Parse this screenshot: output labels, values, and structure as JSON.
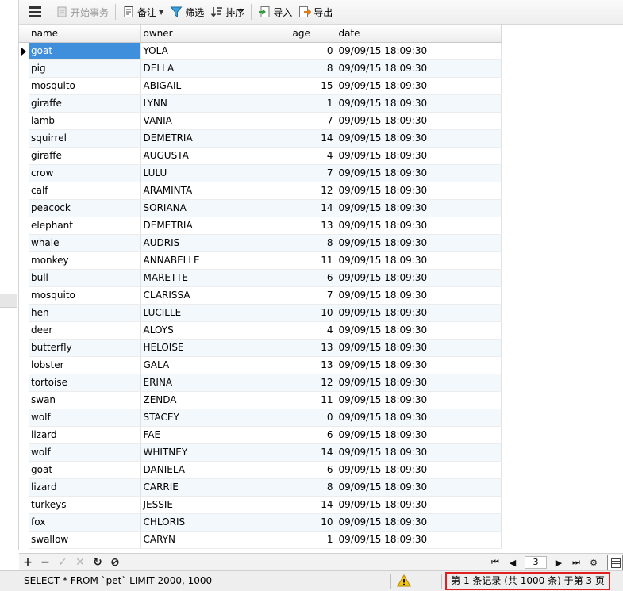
{
  "toolbar": {
    "begin_transaction": "开始事务",
    "memo": "备注",
    "filter": "筛选",
    "sort": "排序",
    "import": "导入",
    "export": "导出"
  },
  "grid": {
    "columns": [
      "name",
      "owner",
      "age",
      "date"
    ],
    "rows": [
      [
        "goat",
        "YOLA",
        "0",
        "09/09/15 18:09:30"
      ],
      [
        "pig",
        "DELLA",
        "8",
        "09/09/15 18:09:30"
      ],
      [
        "mosquito",
        "ABIGAIL",
        "15",
        "09/09/15 18:09:30"
      ],
      [
        "giraffe",
        "LYNN",
        "1",
        "09/09/15 18:09:30"
      ],
      [
        "lamb",
        "VANIA",
        "7",
        "09/09/15 18:09:30"
      ],
      [
        "squirrel",
        "DEMETRIA",
        "14",
        "09/09/15 18:09:30"
      ],
      [
        "giraffe",
        "AUGUSTA",
        "4",
        "09/09/15 18:09:30"
      ],
      [
        "crow",
        "LULU",
        "7",
        "09/09/15 18:09:30"
      ],
      [
        "calf",
        "ARAMINTA",
        "12",
        "09/09/15 18:09:30"
      ],
      [
        "peacock",
        "SORIANA",
        "14",
        "09/09/15 18:09:30"
      ],
      [
        "elephant",
        "DEMETRIA",
        "13",
        "09/09/15 18:09:30"
      ],
      [
        "whale",
        "AUDRIS",
        "8",
        "09/09/15 18:09:30"
      ],
      [
        "monkey",
        "ANNABELLE",
        "11",
        "09/09/15 18:09:30"
      ],
      [
        "bull",
        "MARETTE",
        "6",
        "09/09/15 18:09:30"
      ],
      [
        "mosquito",
        "CLARISSA",
        "7",
        "09/09/15 18:09:30"
      ],
      [
        "hen",
        "LUCILLE",
        "10",
        "09/09/15 18:09:30"
      ],
      [
        "deer",
        "ALOYS",
        "4",
        "09/09/15 18:09:30"
      ],
      [
        "butterfly",
        "HELOISE",
        "13",
        "09/09/15 18:09:30"
      ],
      [
        "lobster",
        "GALA",
        "13",
        "09/09/15 18:09:30"
      ],
      [
        "tortoise",
        "ERINA",
        "12",
        "09/09/15 18:09:30"
      ],
      [
        "swan",
        "ZENDA",
        "11",
        "09/09/15 18:09:30"
      ],
      [
        "wolf",
        "STACEY",
        "0",
        "09/09/15 18:09:30"
      ],
      [
        "lizard",
        "FAE",
        "6",
        "09/09/15 18:09:30"
      ],
      [
        "wolf",
        "WHITNEY",
        "14",
        "09/09/15 18:09:30"
      ],
      [
        "goat",
        "DANIELA",
        "6",
        "09/09/15 18:09:30"
      ],
      [
        "lizard",
        "CARRIE",
        "8",
        "09/09/15 18:09:30"
      ],
      [
        "turkeys",
        "JESSIE",
        "14",
        "09/09/15 18:09:30"
      ],
      [
        "fox",
        "CHLORIS",
        "10",
        "09/09/15 18:09:30"
      ],
      [
        "swallow",
        "CARYN",
        "1",
        "09/09/15 18:09:30"
      ]
    ],
    "selected_row": 0
  },
  "pager": {
    "page": "3"
  },
  "status": {
    "sql": "SELECT * FROM `pet` LIMIT 2000, 1000",
    "page_info": "第 1 条记录 (共 1000 条) 于第 3 页"
  },
  "colors": {
    "selection": "#3f8fdc",
    "highlight_border": "#e02020",
    "alt_row": "#f3f8fd"
  },
  "icons": {
    "menu": "hamburger-icon",
    "transaction": "transaction-icon",
    "memo": "memo-icon",
    "filter": "filter-icon",
    "sort": "sort-icon",
    "import": "import-icon",
    "export": "export-icon",
    "warning": "warning-icon"
  }
}
